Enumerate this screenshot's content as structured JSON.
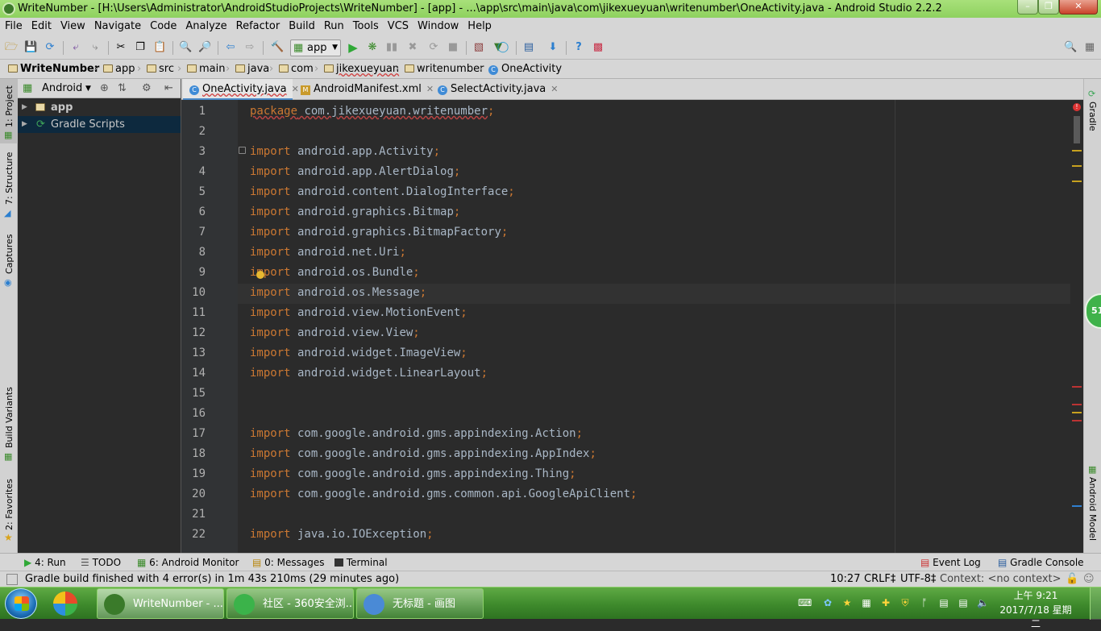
{
  "window": {
    "title": "WriteNumber - [H:\\Users\\Administrator\\AndroidStudioProjects\\WriteNumber] - [app] - ...\\app\\src\\main\\java\\com\\jikexueyuan\\writenumber\\OneActivity.java - Android Studio 2.2.2"
  },
  "menu": [
    "File",
    "Edit",
    "View",
    "Navigate",
    "Code",
    "Analyze",
    "Refactor",
    "Build",
    "Run",
    "Tools",
    "VCS",
    "Window",
    "Help"
  ],
  "toolbar": {
    "run_config": "app"
  },
  "breadcrumb": [
    "WriteNumber",
    "app",
    "src",
    "main",
    "java",
    "com",
    "jikexueyuan",
    "writenumber",
    "OneActivity"
  ],
  "project_panel": {
    "view_mode": "Android",
    "tree": [
      {
        "label": "app"
      },
      {
        "label": "Gradle Scripts"
      }
    ]
  },
  "left_tools": [
    "1: Project",
    "7: Structure",
    "Captures",
    "Build Variants",
    "2: Favorites"
  ],
  "right_tools": [
    "Gradle",
    "Android Model"
  ],
  "tabs": [
    {
      "label": "OneActivity.java",
      "active": true
    },
    {
      "label": "AndroidManifest.xml",
      "active": false
    },
    {
      "label": "SelectActivity.java",
      "active": false
    }
  ],
  "code_lines": [
    {
      "n": "1",
      "kw": "package",
      "rest": " com.jikexueyuan.writenumber",
      "semi": ";"
    },
    {
      "n": "2",
      "kw": "",
      "rest": "",
      "semi": ""
    },
    {
      "n": "3",
      "kw": "import",
      "rest": " android.app.Activity",
      "semi": ";"
    },
    {
      "n": "4",
      "kw": "import",
      "rest": " android.app.AlertDialog",
      "semi": ";"
    },
    {
      "n": "5",
      "kw": "import",
      "rest": " android.content.DialogInterface",
      "semi": ";"
    },
    {
      "n": "6",
      "kw": "import",
      "rest": " android.graphics.Bitmap",
      "semi": ";"
    },
    {
      "n": "7",
      "kw": "import",
      "rest": " android.graphics.BitmapFactory",
      "semi": ";"
    },
    {
      "n": "8",
      "kw": "import",
      "rest": " android.net.Uri",
      "semi": ";"
    },
    {
      "n": "9",
      "kw": "import",
      "rest": " android.os.Bundle",
      "semi": ";"
    },
    {
      "n": "10",
      "kw": "import",
      "rest": " android.os.Message",
      "semi": ";"
    },
    {
      "n": "11",
      "kw": "import",
      "rest": " android.view.MotionEvent",
      "semi": ";"
    },
    {
      "n": "12",
      "kw": "import",
      "rest": " android.view.View",
      "semi": ";"
    },
    {
      "n": "13",
      "kw": "import",
      "rest": " android.widget.ImageView",
      "semi": ";"
    },
    {
      "n": "14",
      "kw": "import",
      "rest": " android.widget.LinearLayout",
      "semi": ";"
    },
    {
      "n": "15",
      "kw": "",
      "rest": "",
      "semi": ""
    },
    {
      "n": "16",
      "kw": "",
      "rest": "",
      "semi": ""
    },
    {
      "n": "17",
      "kw": "import",
      "rest": " com.google.android.gms.appindexing.Action",
      "semi": ";"
    },
    {
      "n": "18",
      "kw": "import",
      "rest": " com.google.android.gms.appindexing.AppIndex",
      "semi": ";"
    },
    {
      "n": "19",
      "kw": "import",
      "rest": " com.google.android.gms.appindexing.Thing",
      "semi": ";"
    },
    {
      "n": "20",
      "kw": "import",
      "rest": " com.google.android.gms.common.api.GoogleApiClient",
      "semi": ";"
    },
    {
      "n": "21",
      "kw": "",
      "rest": "",
      "semi": ""
    },
    {
      "n": "22",
      "kw": "import",
      "rest": " java.io.IOException",
      "semi": ";"
    }
  ],
  "bottom_tools": {
    "run": "4: Run",
    "todo": "TODO",
    "monitor": "6: Android Monitor",
    "messages": "0: Messages",
    "terminal": "Terminal",
    "event_log": "Event Log",
    "gradle_console": "Gradle Console"
  },
  "status": {
    "message": "Gradle build finished with 4 error(s) in 1m 43s 210ms (29 minutes ago)",
    "position": "10:27",
    "line_sep": "CRLF‡",
    "encoding": "UTF-8‡",
    "context": "Context: <no context>"
  },
  "memory_badge": "51",
  "taskbar": {
    "items": [
      {
        "label": "WriteNumber - ...",
        "active": true
      },
      {
        "label": "社区 - 360安全浏...",
        "active": false
      },
      {
        "label": "无标题 - 画图",
        "active": false
      }
    ],
    "time": "上午 9:21",
    "date": "2017/7/18 星期二"
  },
  "colors": {
    "keyword": "#cc7832",
    "identifier": "#a9b7c6",
    "editor_bg": "#2b2b2b",
    "gutter_bg": "#313335",
    "taskbar": "#3e8a2c"
  }
}
